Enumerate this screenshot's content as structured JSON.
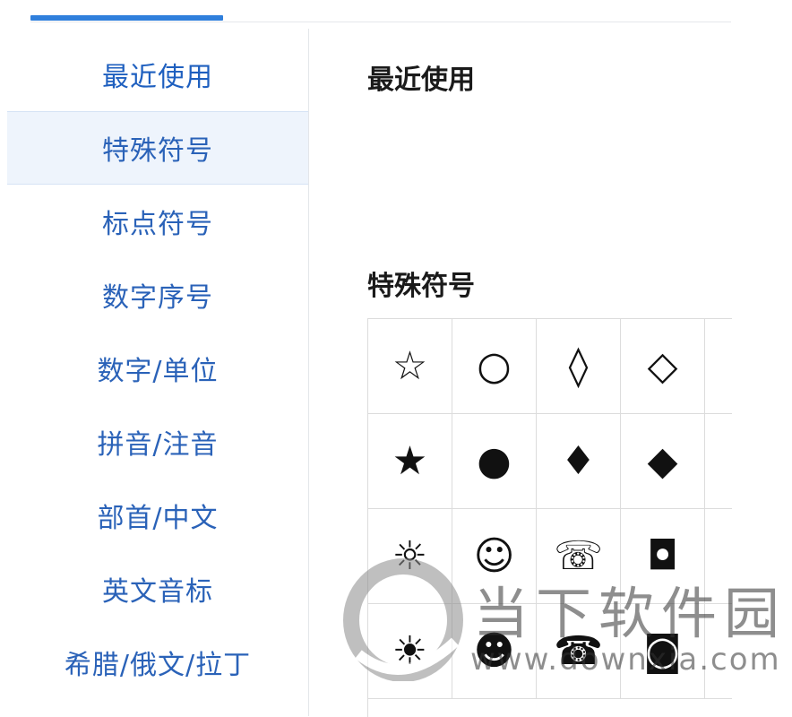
{
  "sidebar": {
    "items": [
      {
        "label": "最近使用"
      },
      {
        "label": "特殊符号"
      },
      {
        "label": "标点符号"
      },
      {
        "label": "数字序号"
      },
      {
        "label": "数字/单位"
      },
      {
        "label": "拼音/注音"
      },
      {
        "label": "部首/中文"
      },
      {
        "label": "英文音标"
      },
      {
        "label": "希腊/俄文/拉丁"
      }
    ],
    "active_index": 1
  },
  "main": {
    "recent_title": "最近使用",
    "special_title": "特殊符号",
    "symbols": [
      [
        "☆",
        "○",
        "◊",
        "◇",
        "│"
      ],
      [
        "★",
        "●",
        "♦",
        "◆",
        "│"
      ],
      [
        "☼",
        "☺",
        "☏",
        "◘",
        "‛"
      ],
      [
        "☀",
        "☻",
        "☎",
        "◙",
        "‚"
      ]
    ]
  },
  "watermark": {
    "text": "当下软件园",
    "url": "www.downxia.com"
  },
  "colors": {
    "accent": "#2f7fdc",
    "sidebar_text": "#2a62b8",
    "active_bg": "#eef4fc"
  }
}
